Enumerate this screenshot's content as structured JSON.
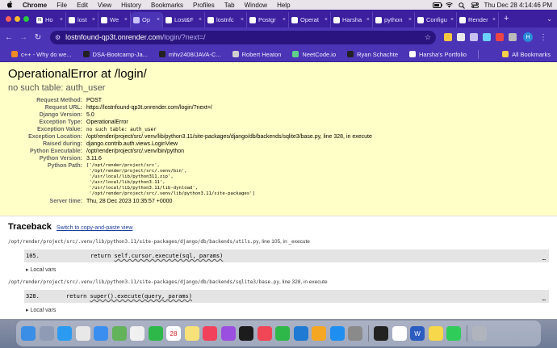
{
  "menubar": {
    "apple": "",
    "items": [
      "Chrome",
      "File",
      "Edit",
      "View",
      "History",
      "Bookmarks",
      "Profiles",
      "Tab",
      "Window",
      "Help"
    ],
    "datetime": "Thu Dec 28  4:14:46 PM"
  },
  "tabs": [
    {
      "label": "Ho",
      "fav": "N"
    },
    {
      "label": "lost",
      "fav": ""
    },
    {
      "label": "We",
      "fav": ""
    },
    {
      "label": "Op",
      "fav": "",
      "active": true
    },
    {
      "label": "Lost&F",
      "fav": ""
    },
    {
      "label": "lostnfc",
      "fav": ""
    },
    {
      "label": "Postgr",
      "fav": ""
    },
    {
      "label": "Operat",
      "fav": ""
    },
    {
      "label": "Harsha",
      "fav": ""
    },
    {
      "label": "python",
      "fav": ""
    },
    {
      "label": "Configu",
      "fav": ""
    },
    {
      "label": "Render",
      "fav": ""
    }
  ],
  "toolbar": {
    "url_host": "lostnfound-qp3t.onrender.com",
    "url_path": "/login/?next=/",
    "profile_initial": "H"
  },
  "bookmarks": [
    {
      "label": "c++ - Why do we...",
      "color": "#f08a24"
    },
    {
      "label": "DSA-Bootcamp-Ja...",
      "color": "#222222"
    },
    {
      "label": "mhv2408/JAVA-C...",
      "color": "#222222"
    },
    {
      "label": "Robert Heaton",
      "color": "#d0d0d0"
    },
    {
      "label": "NeetCode.io",
      "color": "#5fd08a"
    },
    {
      "label": "Ryan Schachte",
      "color": "#222222"
    },
    {
      "label": "Harsha's Portfolio",
      "color": "#ffffff"
    }
  ],
  "all_bookmarks": "All Bookmarks",
  "error": {
    "title": "OperationalError at /login/",
    "subtitle": "no such table: auth_user",
    "rows": [
      {
        "label": "Request Method:",
        "value": "POST"
      },
      {
        "label": "Request URL:",
        "value": "https://lostnfound-qp3t.onrender.com/login/?next=/"
      },
      {
        "label": "Django Version:",
        "value": "5.0"
      },
      {
        "label": "Exception Type:",
        "value": "OperationalError"
      },
      {
        "label": "Exception Value:",
        "value": "no such table: auth_user"
      },
      {
        "label": "Exception Location:",
        "value": "/opt/render/project/src/.venv/lib/python3.11/site-packages/django/db/backends/sqlite3/base.py, line 328, in execute"
      },
      {
        "label": "Raised during:",
        "value": "django.contrib.auth.views.LoginView"
      },
      {
        "label": "Python Executable:",
        "value": "/opt/render/project/src/.venv/bin/python"
      },
      {
        "label": "Python Version:",
        "value": "3.11.6"
      }
    ],
    "python_path_label": "Python Path:",
    "python_path": "['/opt/render/project/src',\n '/opt/render/project/src/.venv/bin',\n '/usr/local/lib/python311.zip',\n '/usr/local/lib/python3.11',\n '/usr/local/lib/python3.11/lib-dynload',\n '/opt/render/project/src/.venv/lib/python3.11/site-packages']",
    "server_time_label": "Server time:",
    "server_time": "Thu, 28 Dec 2023 10:35:57 +0000"
  },
  "traceback": {
    "title": "Traceback",
    "switch_link": "Switch to copy-and-paste view",
    "frames": [
      {
        "file": "/opt/render/project/src/.venv/lib/python3.11/site-packages/django/db/backends/utils.py",
        "meta": ", line 105, in _execute",
        "lineno": "105.",
        "code_prefix": "return ",
        "code_call": "self.cursor.execute(sql, params)",
        "local_vars": "Local vars"
      },
      {
        "file": "/opt/render/project/src/.venv/lib/python3.11/site-packages/django/db/backends/sqlite3/base.py",
        "meta": ", line 328, in execute",
        "lineno": "328.",
        "code_prefix": "return ",
        "code_call": "super().execute(query, params)",
        "local_vars": "Local vars"
      }
    ]
  },
  "dock": {
    "apps": [
      {
        "name": "finder-icon",
        "color": "#3a8ee6",
        "glyph": ""
      },
      {
        "name": "launchpad-icon",
        "color": "#8f9bb5",
        "glyph": ""
      },
      {
        "name": "safari-icon",
        "color": "#2a9bf0",
        "glyph": ""
      },
      {
        "name": "chrome-icon",
        "color": "#e8e8e8",
        "glyph": ""
      },
      {
        "name": "mail-icon",
        "color": "#3a8ef0",
        "glyph": ""
      },
      {
        "name": "maps-icon",
        "color": "#62b35a",
        "glyph": ""
      },
      {
        "name": "photos-icon",
        "color": "#f0f0f0",
        "glyph": ""
      },
      {
        "name": "facetime-icon",
        "color": "#2fb84a",
        "glyph": ""
      },
      {
        "name": "calendar-icon",
        "color": "#ffffff",
        "glyph": "28"
      },
      {
        "name": "notes-icon",
        "color": "#f7e27a",
        "glyph": ""
      },
      {
        "name": "music-icon",
        "color": "#f2415a",
        "glyph": ""
      },
      {
        "name": "podcasts-icon",
        "color": "#9b4fe0",
        "glyph": ""
      },
      {
        "name": "tv-icon",
        "color": "#1c1c1c",
        "glyph": ""
      },
      {
        "name": "news-icon",
        "color": "#f04656",
        "glyph": ""
      },
      {
        "name": "numbers-icon",
        "color": "#2fb84a",
        "glyph": ""
      },
      {
        "name": "vscode-icon",
        "color": "#1e7ad2",
        "glyph": ""
      },
      {
        "name": "pages-icon",
        "color": "#f5a623",
        "glyph": ""
      },
      {
        "name": "appstore-icon",
        "color": "#1e8ef0",
        "glyph": ""
      },
      {
        "name": "settings-icon",
        "color": "#8a8a8a",
        "glyph": ""
      },
      {
        "name": "terminal-icon",
        "color": "#222222",
        "glyph": ""
      },
      {
        "name": "slack-icon",
        "color": "#ffffff",
        "glyph": ""
      },
      {
        "name": "word-icon",
        "color": "#2b5cc0",
        "glyph": "W"
      },
      {
        "name": "notes-yellow-icon",
        "color": "#f7d84a",
        "glyph": ""
      },
      {
        "name": "whatsapp-icon",
        "color": "#2fcc5a",
        "glyph": ""
      },
      {
        "name": "trash-icon",
        "color": "#b0b4bc",
        "glyph": ""
      }
    ]
  }
}
